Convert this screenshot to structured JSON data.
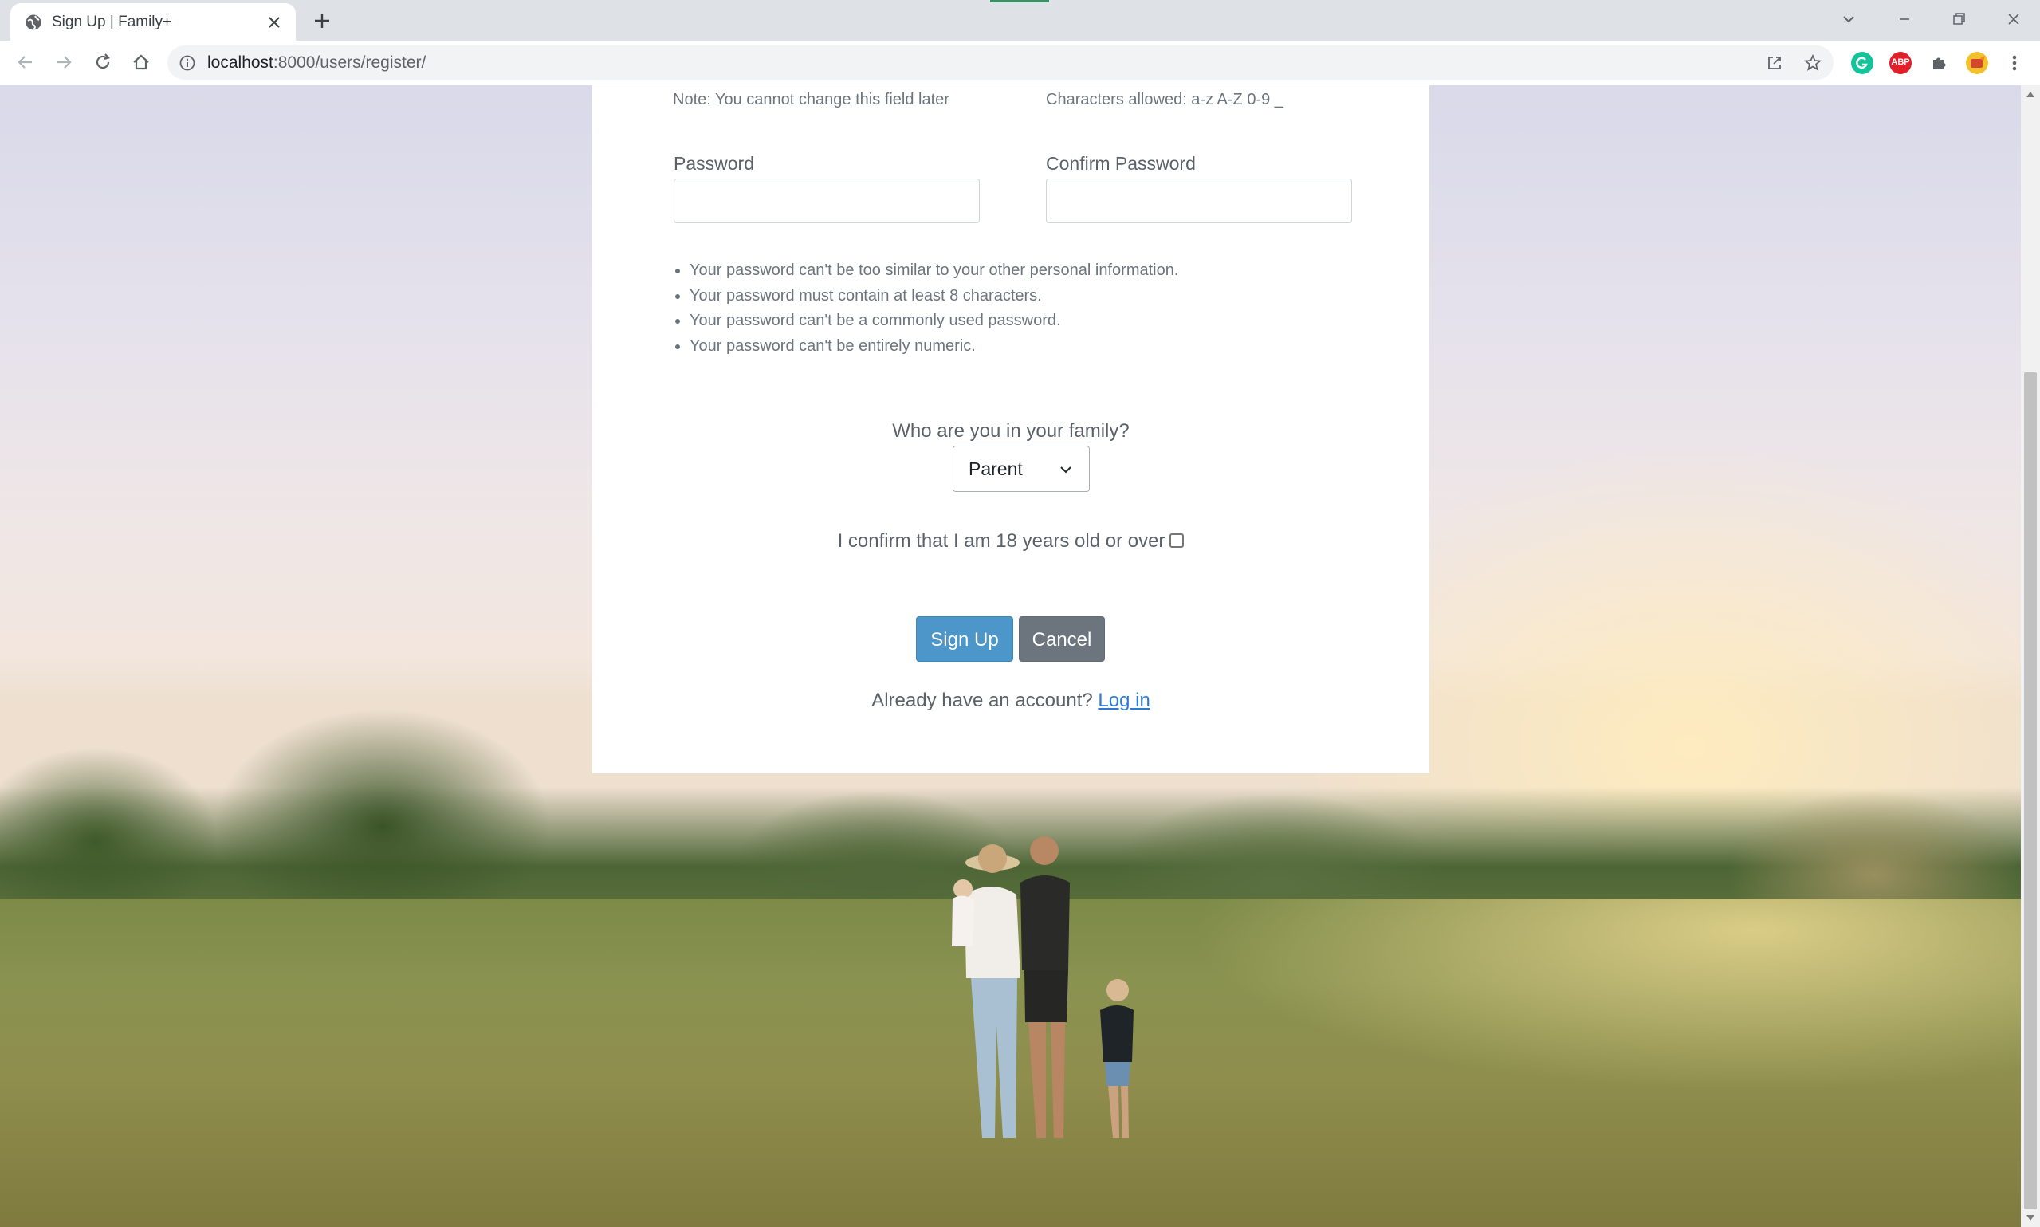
{
  "browser": {
    "tab_title": "Sign Up | Family+",
    "url_host": "localhost",
    "url_path": ":8000/users/register/",
    "extensions": {
      "abp_label": "ABP"
    }
  },
  "form": {
    "username_note": "Note: You cannot change this field later",
    "characters_note": "Characters allowed: a-z A-Z 0-9 _",
    "password_label": "Password",
    "confirm_password_label": "Confirm Password",
    "password_value": "",
    "confirm_password_value": "",
    "password_help": [
      "Your password can't be too similar to your other personal information.",
      "Your password must contain at least 8 characters.",
      "Your password can't be a commonly used password.",
      "Your password can't be entirely numeric."
    ],
    "family_role_label": "Who are you in your family?",
    "family_role_value": "Parent",
    "age_confirm_label": "I confirm that I am 18 years old or over",
    "age_confirmed": false,
    "signup_button": "Sign Up",
    "cancel_button": "Cancel",
    "login_prompt": "Already have an account?",
    "login_link": "Log in"
  },
  "colors": {
    "primary_button": "#4c96c9",
    "secondary_button": "#6c757d",
    "link": "#2b7bd6"
  }
}
